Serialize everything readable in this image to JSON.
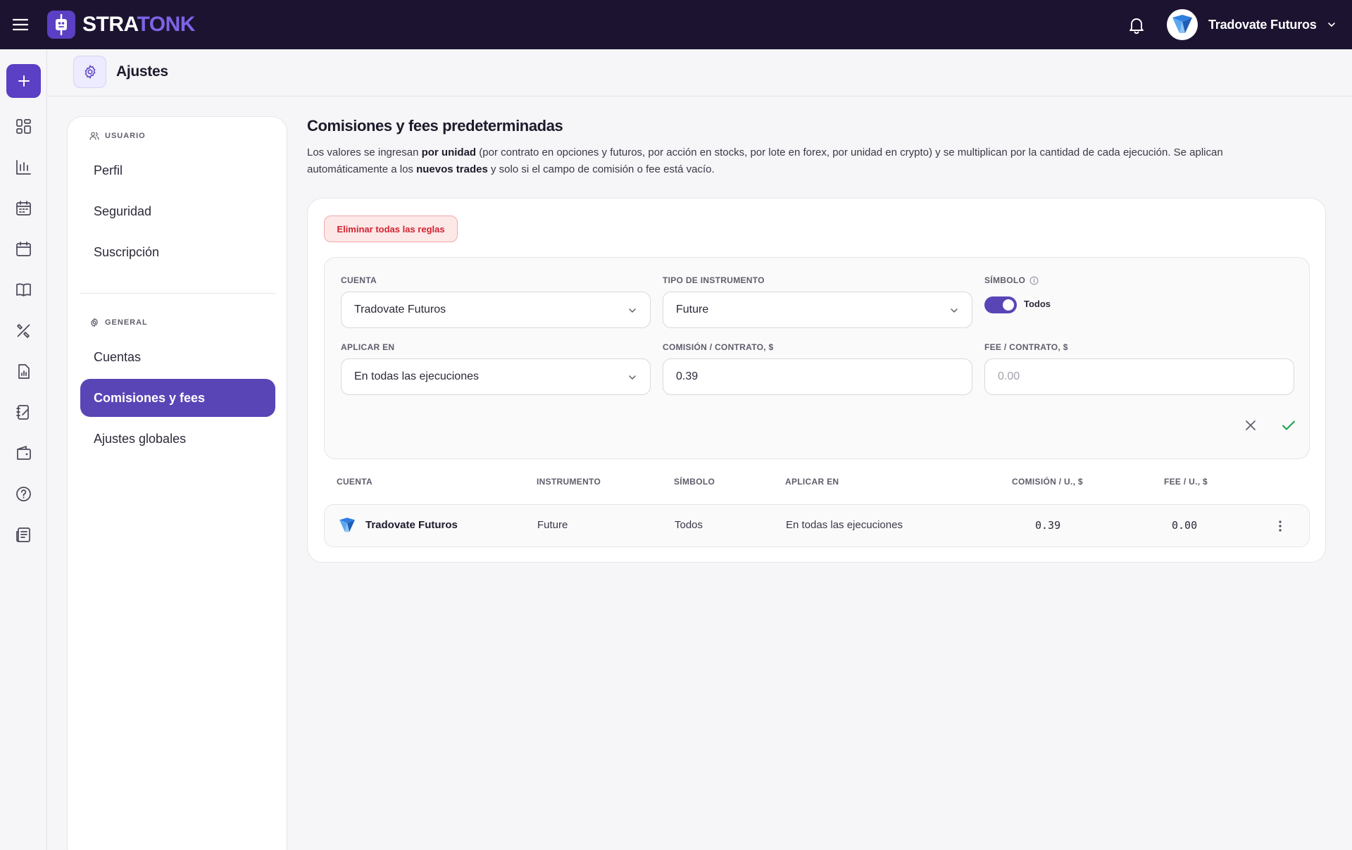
{
  "app": {
    "logo_part1": "STRA",
    "logo_part2": "TONK",
    "brand_color": "#5b3fc4"
  },
  "topbar": {
    "user_name": "Tradovate Futuros",
    "icons": [
      "menu-icon",
      "bell-icon",
      "chevron-down-icon"
    ]
  },
  "rail": {
    "icons": [
      "plus-icon",
      "dashboard-icon",
      "chart-icon",
      "calendar-grid-icon",
      "calendar-icon",
      "book-icon",
      "tools-icon",
      "report-icon",
      "journal-icon",
      "wallet-icon",
      "help-icon",
      "news-icon"
    ]
  },
  "header": {
    "title": "Ajustes"
  },
  "settings_nav": {
    "section_user": "USUARIO",
    "section_general": "GENERAL",
    "items": [
      {
        "label": "Perfil"
      },
      {
        "label": "Seguridad"
      },
      {
        "label": "Suscripción"
      },
      {
        "label": "Cuentas"
      },
      {
        "label": "Comisiones y fees",
        "active": true
      },
      {
        "label": "Ajustes globales"
      }
    ]
  },
  "main": {
    "title": "Comisiones y fees predeterminadas",
    "desc_1": "Los valores se ingresan ",
    "desc_2": "por unidad",
    "desc_3": " (por contrato en opciones y futuros, por acción en stocks, por lote en forex, por unidad en crypto) y se multiplican por la cantidad de cada ejecución. Se aplican automáticamente a los ",
    "desc_4": "nuevos trades",
    "desc_5": " y solo si el campo de comisión o fee está vacío.",
    "delete_all_label": "Eliminar todas las reglas"
  },
  "form": {
    "account_label": "CUENTA",
    "account_value": "Tradovate Futuros",
    "instrument_label": "TIPO DE INSTRUMENTO",
    "instrument_value": "Future",
    "symbol_label": "SÍMBOLO",
    "symbol_toggle_label": "Todos",
    "symbol_all_enabled": true,
    "apply_label": "APLICAR EN",
    "apply_value": "En todas las ejecuciones",
    "commission_label": "COMISIÓN / CONTRATO, $",
    "commission_value": "0.39",
    "fee_label": "FEE / CONTRATO, $",
    "fee_placeholder": "0.00"
  },
  "table": {
    "headers": [
      "CUENTA",
      "INSTRUMENTO",
      "SÍMBOLO",
      "APLICAR EN",
      "COMISIÓN / U., $",
      "FEE / U., $"
    ],
    "rows": [
      {
        "account": "Tradovate Futuros",
        "instrument": "Future",
        "symbol": "Todos",
        "apply": "En todas las ejecuciones",
        "commission": "0.39",
        "fee": "0.00"
      }
    ]
  }
}
